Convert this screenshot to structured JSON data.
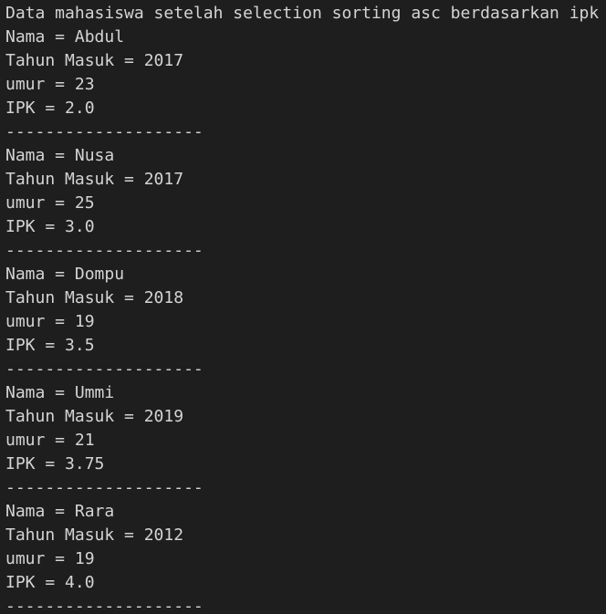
{
  "terminal": {
    "header": "Data mahasiswa setelah selection sorting asc berdasarkan ipk",
    "records": [
      {
        "nama": "Nama = Abdul",
        "tahun": "Tahun Masuk = 2017",
        "umur": "umur = 23",
        "ipk": "IPK = 2.0",
        "separator": "--------------------"
      },
      {
        "nama": "Nama = Nusa",
        "tahun": "Tahun Masuk = 2017",
        "umur": "umur = 25",
        "ipk": "IPK = 3.0",
        "separator": "--------------------"
      },
      {
        "nama": "Nama = Dompu",
        "tahun": "Tahun Masuk = 2018",
        "umur": "umur = 19",
        "ipk": "IPK = 3.5",
        "separator": "--------------------"
      },
      {
        "nama": "Nama = Ummi",
        "tahun": "Tahun Masuk = 2019",
        "umur": "umur = 21",
        "ipk": "IPK = 3.75",
        "separator": "--------------------"
      },
      {
        "nama": "Nama = Rara",
        "tahun": "Tahun Masuk = 2012",
        "umur": "umur = 19",
        "ipk": "IPK = 4.0",
        "separator": "--------------------"
      }
    ]
  },
  "colors": {
    "background": "#1e1e1e",
    "text": "#d4d4d4"
  }
}
